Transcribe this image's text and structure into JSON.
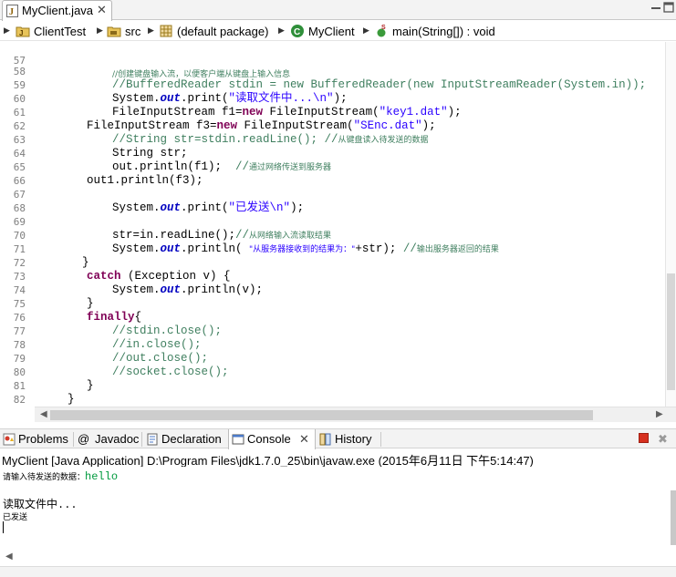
{
  "editor_tab": {
    "label": "MyClient.java",
    "close_glyph": "✕"
  },
  "window_controls": {
    "minimize": "minimize-icon",
    "maximize": "maximize-icon"
  },
  "breadcrumb": {
    "project": "ClientTest",
    "folder": "src",
    "package": "(default package)",
    "class": "MyClient",
    "method": "main(String[]) : void"
  },
  "code": {
    "line_numbers": [
      "57",
      "58",
      "59",
      "60",
      "61",
      "62",
      "63",
      "64",
      "65",
      "66",
      "67",
      "68",
      "69",
      "70",
      "71",
      "72",
      "73",
      "74",
      "75",
      "76",
      "77",
      "78",
      "79",
      "80",
      "81",
      "82",
      "83"
    ],
    "l57_comment": "//创建键盘输入流，以便客户端从键盘上输入信息",
    "l58_comment": "//BufferedReader stdin = new BufferedReader(new InputStreamReader(System.in));",
    "l59_a": "System.",
    "l59_field": "out",
    "l59_b": ".print(",
    "l59_str": "\"读取文件中...\\n\"",
    "l59_c": ");",
    "l60_a": "FileInputStream f1=",
    "l60_kw": "new",
    "l60_b": " FileInputStream(",
    "l60_str": "\"key1.dat\"",
    "l60_c": ");",
    "l61_a": "FileInputStream f3=",
    "l61_kw": "new",
    "l61_b": " FileInputStream(",
    "l61_str": "\"SEnc.dat\"",
    "l61_c": ");",
    "l62_comment": "//String str=stdin.readLine(); //",
    "l62_comment_cn": "从键盘读入待发送的数据",
    "l63": "String str;",
    "l64_a": "out.println(f1);  ",
    "l64_comment": "//",
    "l64_comment_cn": "通过网络传送到服务器",
    "l65": "out1.println(f3);",
    "l67_a": "System.",
    "l67_field": "out",
    "l67_b": ".print(",
    "l67_str": "\"已发送\\n\"",
    "l67_c": ");",
    "l69_a": "str=in.readLine();",
    "l69_comment": "//",
    "l69_comment_cn": "从网络输入流读取结果",
    "l70_a": "System.",
    "l70_field": "out",
    "l70_b": ".println( ",
    "l70_str": "\"从服务器接收到的结果为：\"",
    "l70_c": "+str); ",
    "l70_comment": "//",
    "l70_comment_cn": "输出服务器返回的结果",
    "l71": "}",
    "l72_kw": "catch",
    "l72_b": " (Exception v) {",
    "l73_a": "System.",
    "l73_field": "out",
    "l73_b": ".println(v);",
    "l74": "}",
    "l75_kw": "finally",
    "l75_b": "{",
    "l76": "//stdin.close();",
    "l77": "//in.close();",
    "l78": "//out.close();",
    "l79": "//socket.close();",
    "l80": "}",
    "l81": "}",
    "l82": "}"
  },
  "views": {
    "tabs": [
      {
        "label": "Problems",
        "icon": "problems-icon"
      },
      {
        "label": "Javadoc",
        "icon": "at-icon"
      },
      {
        "label": "Declaration",
        "icon": "declaration-icon"
      },
      {
        "label": "Console",
        "icon": "console-icon"
      },
      {
        "label": "History",
        "icon": "history-icon"
      }
    ],
    "close_glyph": "✕"
  },
  "console": {
    "header": "MyClient [Java Application] D:\\Program Files\\jdk1.7.0_25\\bin\\javaw.exe (2015年6月11日 下午5:14:47)",
    "prompt": "请输入待发送的数据：",
    "input": "hello",
    "reading": "读取文件中...",
    "sent": "已发送"
  },
  "colors": {
    "keyword": "#7f0055",
    "comment": "#3f7f5f",
    "string": "#2a00ff",
    "field": "#0000c0",
    "console_input": "#009a3e"
  }
}
